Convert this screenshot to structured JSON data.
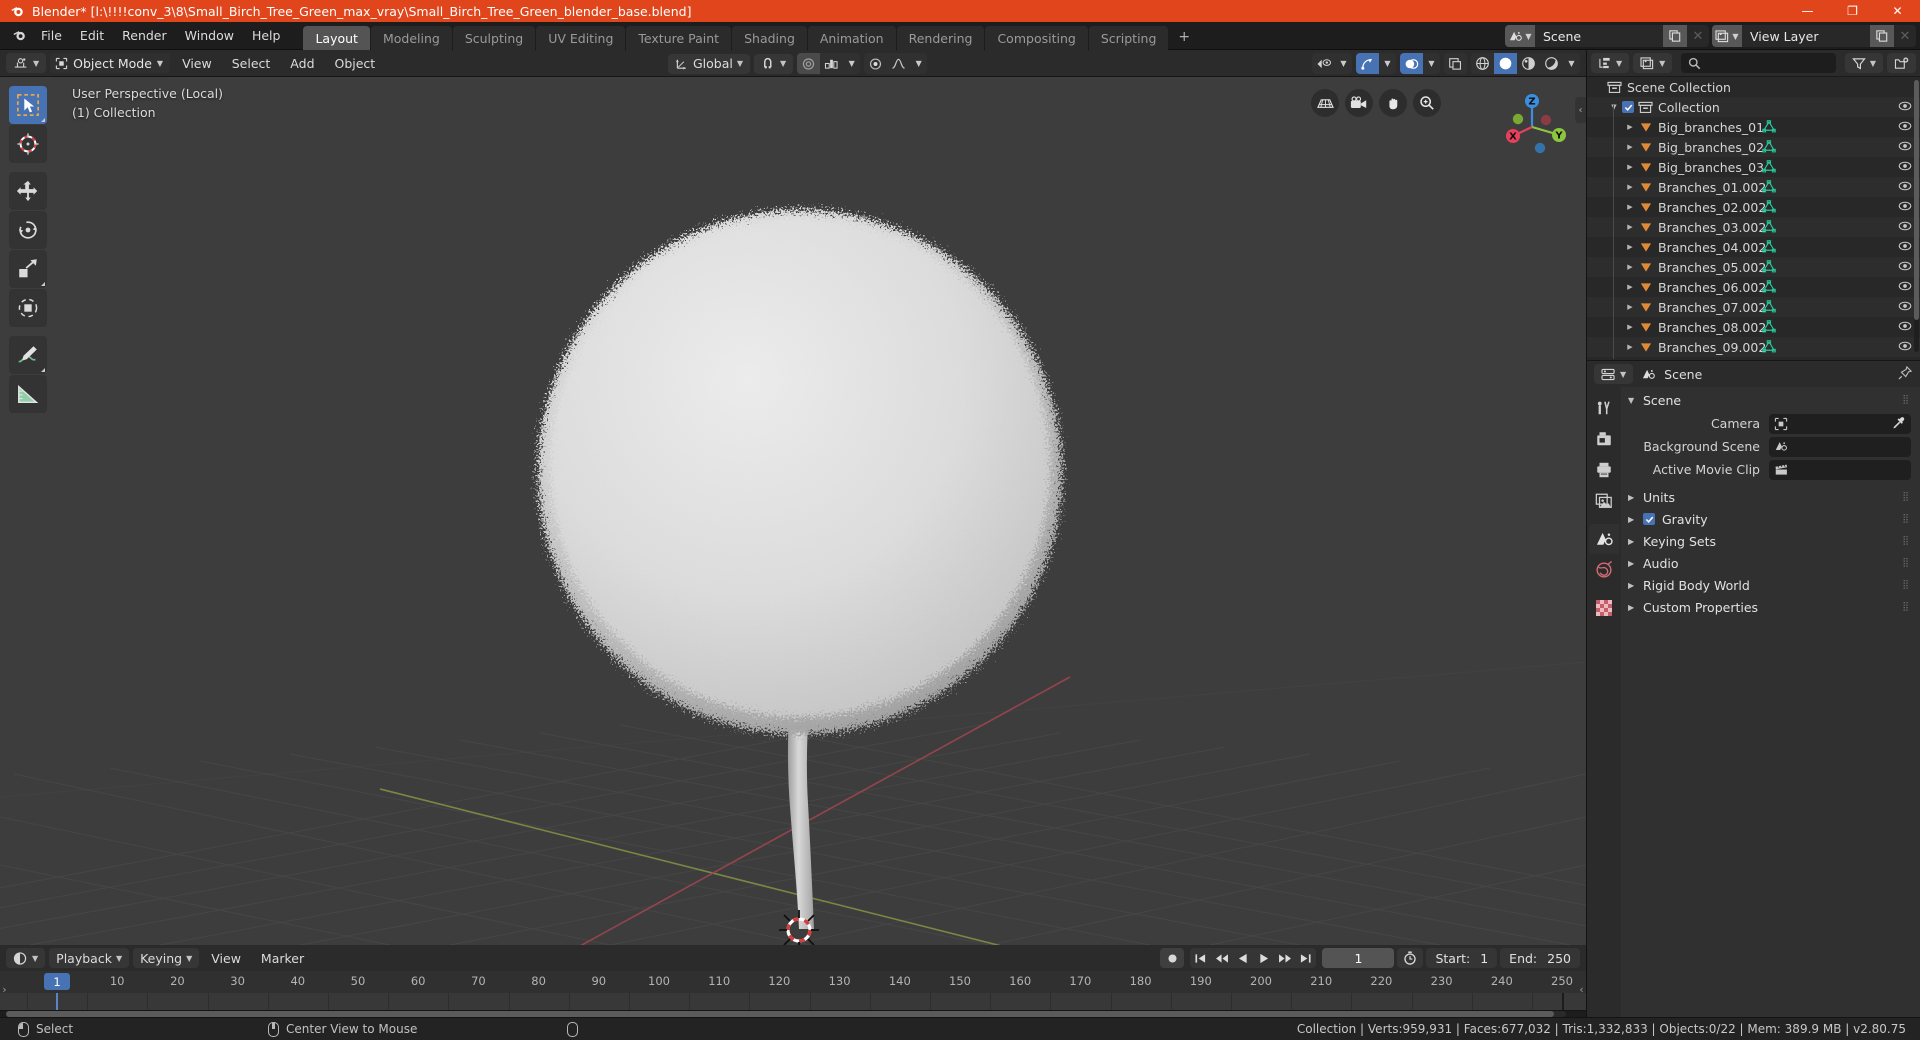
{
  "window": {
    "title": "Blender* [l:\\!!!!conv_3\\8\\Small_Birch_Tree_Green_max_vray\\Small_Birch_Tree_Green_blender_base.blend]",
    "minimize": "—",
    "maximize": "❐",
    "close": "✕",
    "accent": "#e0451c"
  },
  "topbar": {
    "menus": [
      "File",
      "Edit",
      "Render",
      "Window",
      "Help"
    ],
    "workspaces": [
      {
        "label": "Layout",
        "active": true
      },
      {
        "label": "Modeling",
        "active": false
      },
      {
        "label": "Sculpting",
        "active": false
      },
      {
        "label": "UV Editing",
        "active": false
      },
      {
        "label": "Texture Paint",
        "active": false
      },
      {
        "label": "Shading",
        "active": false
      },
      {
        "label": "Animation",
        "active": false
      },
      {
        "label": "Rendering",
        "active": false
      },
      {
        "label": "Compositing",
        "active": false
      },
      {
        "label": "Scripting",
        "active": false
      }
    ],
    "add_workspace": "+",
    "scene_name": "Scene",
    "view_layer_name": "View Layer",
    "new_copy_icon": "copy-icon",
    "unlink_icon": "✕"
  },
  "viewport_header": {
    "editor_type_icon": "editor-type-3dview-icon",
    "mode": "Object Mode",
    "menus": [
      "View",
      "Select",
      "Add",
      "Object"
    ],
    "transform_orientation": "Global",
    "snap_icon": "magnet-icon",
    "proportional_icon": "proportional-edit-icon",
    "pivot_icon": "pivot-point-icon",
    "falloff_icon": "smooth-falloff-icon",
    "visibility_icon": "visibility-icon",
    "gizmo_icon": "gizmo-icon",
    "overlays_icon": "overlays-icon",
    "xray_icon": "xray-icon",
    "shading_modes": [
      "wireframe",
      "solid",
      "material-preview",
      "rendered"
    ],
    "shading_active": "solid"
  },
  "viewport": {
    "overlay_line1": "User Perspective (Local)",
    "overlay_line2": "(1) Collection",
    "tools": [
      {
        "name": "tweak-select-box-tool",
        "active": true
      },
      {
        "name": "cursor-tool",
        "active": false
      },
      {
        "name": "move-tool",
        "active": false
      },
      {
        "name": "rotate-tool",
        "active": false
      },
      {
        "name": "scale-tool",
        "active": false
      },
      {
        "name": "transform-tool",
        "active": false
      },
      {
        "name": "annotate-tool",
        "active": false
      },
      {
        "name": "measure-tool",
        "active": false
      }
    ],
    "nav_buttons": [
      "toggle-ortho-icon",
      "camera-view-icon",
      "pan-view-icon",
      "zoom-view-icon"
    ],
    "gizmo_axes": [
      "X",
      "Y",
      "Z"
    ],
    "background": "#3d3d3d",
    "grid_color": "#4b4b4b",
    "axis_x_color": "#9c4c56",
    "axis_y_color": "#8a9c4c"
  },
  "timeline": {
    "editor_type_icon": "editor-type-timeline-icon",
    "menus": [
      "Playback",
      "Keying",
      "View",
      "Marker"
    ],
    "record_icon": "record-icon",
    "transport": [
      "jump-start-icon",
      "prev-keyframe-icon",
      "play-reverse-icon",
      "play-icon",
      "next-keyframe-icon",
      "jump-end-icon"
    ],
    "current_frame": "1",
    "use_preview_range_icon": "stopwatch-icon",
    "start_label": "Start:",
    "start_value": "1",
    "end_label": "End:",
    "end_value": "250",
    "ticks": [
      "1",
      "10",
      "20",
      "30",
      "40",
      "50",
      "60",
      "70",
      "80",
      "90",
      "100",
      "110",
      "120",
      "130",
      "140",
      "150",
      "160",
      "170",
      "180",
      "190",
      "200",
      "210",
      "220",
      "230",
      "240",
      "250"
    ]
  },
  "outliner": {
    "display_mode_icon": "outliner-display-mode-icon",
    "filter_id_icon": "filter-id-icon",
    "search_placeholder": "",
    "search_icon": "search-icon",
    "filter_icon": "funnel-icon",
    "new_collection_icon": "new-collection-icon",
    "rows": [
      {
        "label": "Scene Collection",
        "type": "scene-collection",
        "indent": 0,
        "expander": "",
        "checkbox": false,
        "mesh": false,
        "eye": false
      },
      {
        "label": "Collection",
        "type": "collection",
        "indent": 1,
        "expander": "▼",
        "checkbox": true,
        "mesh": false,
        "eye": true
      },
      {
        "label": "Big_branches_01",
        "type": "object",
        "indent": 2,
        "expander": "▶",
        "checkbox": false,
        "mesh": true,
        "eye": true
      },
      {
        "label": "Big_branches_02",
        "type": "object",
        "indent": 2,
        "expander": "▶",
        "checkbox": false,
        "mesh": true,
        "eye": true
      },
      {
        "label": "Big_branches_03",
        "type": "object",
        "indent": 2,
        "expander": "▶",
        "checkbox": false,
        "mesh": true,
        "eye": true
      },
      {
        "label": "Branches_01.002",
        "type": "object",
        "indent": 2,
        "expander": "▶",
        "checkbox": false,
        "mesh": true,
        "eye": true
      },
      {
        "label": "Branches_02.002",
        "type": "object",
        "indent": 2,
        "expander": "▶",
        "checkbox": false,
        "mesh": true,
        "eye": true
      },
      {
        "label": "Branches_03.002",
        "type": "object",
        "indent": 2,
        "expander": "▶",
        "checkbox": false,
        "mesh": true,
        "eye": true
      },
      {
        "label": "Branches_04.002",
        "type": "object",
        "indent": 2,
        "expander": "▶",
        "checkbox": false,
        "mesh": true,
        "eye": true
      },
      {
        "label": "Branches_05.002",
        "type": "object",
        "indent": 2,
        "expander": "▶",
        "checkbox": false,
        "mesh": true,
        "eye": true
      },
      {
        "label": "Branches_06.002",
        "type": "object",
        "indent": 2,
        "expander": "▶",
        "checkbox": false,
        "mesh": true,
        "eye": true
      },
      {
        "label": "Branches_07.002",
        "type": "object",
        "indent": 2,
        "expander": "▶",
        "checkbox": false,
        "mesh": true,
        "eye": true
      },
      {
        "label": "Branches_08.002",
        "type": "object",
        "indent": 2,
        "expander": "▶",
        "checkbox": false,
        "mesh": true,
        "eye": true
      },
      {
        "label": "Branches_09.002",
        "type": "object",
        "indent": 2,
        "expander": "▶",
        "checkbox": false,
        "mesh": true,
        "eye": true
      }
    ]
  },
  "properties": {
    "editor_type_icon": "editor-type-properties-icon",
    "breadcrumb_icon": "scene-icon",
    "breadcrumb": "Scene",
    "pin_icon": "pin-icon",
    "tabs": [
      {
        "name": "tool-tab",
        "icon": "tool-icon",
        "active": false
      },
      {
        "name": "render-tab",
        "icon": "render-camera-icon",
        "active": false
      },
      {
        "name": "output-tab",
        "icon": "printer-icon",
        "active": false
      },
      {
        "name": "view-layer-tab",
        "icon": "images-icon",
        "active": false
      },
      {
        "name": "scene-tab",
        "icon": "scene-icon",
        "active": true
      },
      {
        "name": "world-tab",
        "icon": "world-icon",
        "active": false
      },
      {
        "name": "texture-tab",
        "icon": "checker-icon",
        "active": false
      }
    ],
    "panels": [
      {
        "title": "Scene",
        "open": true,
        "tri": "▼"
      },
      {
        "title": "Units",
        "open": false,
        "tri": "▶"
      },
      {
        "title": "Gravity",
        "open": false,
        "tri": "▶",
        "checkbox": true
      },
      {
        "title": "Keying Sets",
        "open": false,
        "tri": "▶"
      },
      {
        "title": "Audio",
        "open": false,
        "tri": "▶"
      },
      {
        "title": "Rigid Body World",
        "open": false,
        "tri": "▶"
      },
      {
        "title": "Custom Properties",
        "open": false,
        "tri": "▶"
      }
    ],
    "fields": [
      {
        "label": "Camera",
        "value": "",
        "icon": "camera-data-icon",
        "eyedropper": true
      },
      {
        "label": "Background Scene",
        "value": "",
        "icon": "scene-icon",
        "eyedropper": false
      },
      {
        "label": "Active Movie Clip",
        "value": "",
        "icon": "clip-icon",
        "eyedropper": false
      }
    ]
  },
  "statusbar": {
    "left_items": [
      {
        "mouse": "lmb",
        "label": "Select"
      },
      {
        "mouse": "mmb",
        "label": "Center View to Mouse"
      },
      {
        "mouse": "rmb",
        "label": ""
      }
    ],
    "stats": "Collection | Verts:959,931 | Faces:677,032 | Tris:1,332,833 | Objects:0/22 | Mem: 389.9 MB | v2.80.75"
  }
}
